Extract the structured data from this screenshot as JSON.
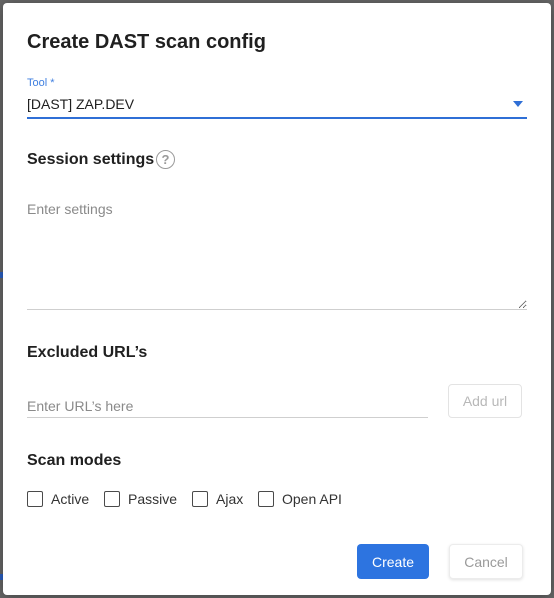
{
  "dialog": {
    "title": "Create DAST scan config",
    "tool": {
      "label": "Tool *",
      "value": "[DAST] ZAP.DEV"
    },
    "session_settings": {
      "title": "Session settings",
      "help_glyph": "?",
      "placeholder": "Enter settings"
    },
    "excluded_urls": {
      "title": "Excluded URL’s",
      "placeholder": "Enter URL’s here",
      "add_label": "Add url"
    },
    "scan_modes": {
      "title": "Scan modes",
      "options": [
        {
          "label": "Active",
          "checked": false
        },
        {
          "label": "Passive",
          "checked": false
        },
        {
          "label": "Ajax",
          "checked": false
        },
        {
          "label": "Open API",
          "checked": false
        }
      ]
    },
    "actions": {
      "create_label": "Create",
      "cancel_label": "Cancel"
    }
  },
  "colors": {
    "accent": "#2d74e0",
    "backdrop": "#676767",
    "disabled_text": "#b8b8b8"
  },
  "icons": {
    "tool_select": "chevron-down-icon",
    "help": "help-circle-icon",
    "checkbox": "checkbox-empty-icon"
  }
}
